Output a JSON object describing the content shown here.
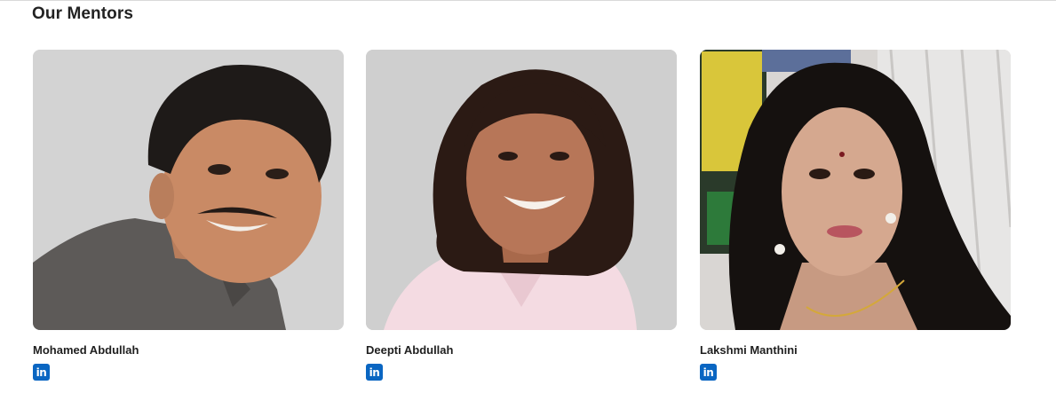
{
  "section": {
    "title": "Our Mentors"
  },
  "colors": {
    "linkedin": "#0a66c2",
    "title": "#222222",
    "name": "#1f1f1f"
  },
  "mentors": [
    {
      "name": "Mohamed Abdullah",
      "icon": "linkedin-icon",
      "icon_text": "in"
    },
    {
      "name": "Deepti Abdullah",
      "icon": "linkedin-icon",
      "icon_text": "in"
    },
    {
      "name": "Lakshmi Manthini",
      "icon": "linkedin-icon",
      "icon_text": "in"
    }
  ]
}
